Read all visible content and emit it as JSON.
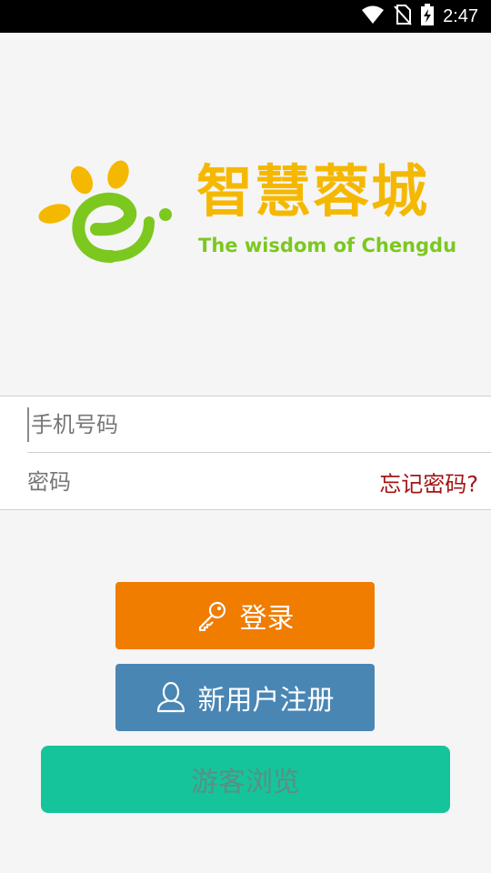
{
  "status_bar": {
    "time": "2:47",
    "icons": [
      "wifi-icon",
      "no-sim-icon",
      "battery-charging-icon"
    ]
  },
  "logo": {
    "title_cn": "智慧蓉城",
    "subtitle_en": "The wisdom of Chengdu",
    "colors": {
      "orange": "#f5b800",
      "green": "#7cc81f"
    }
  },
  "form": {
    "phone_placeholder": "手机号码",
    "password_placeholder": "密码",
    "forgot_password": "忘记密码?"
  },
  "buttons": {
    "login": "登录",
    "register": "新用户注册",
    "guest": "游客浏览"
  },
  "colors": {
    "login_button": "#f07c00",
    "register_button": "#4a86b4",
    "guest_button": "#16c49c",
    "forgot_link": "#a31515"
  }
}
